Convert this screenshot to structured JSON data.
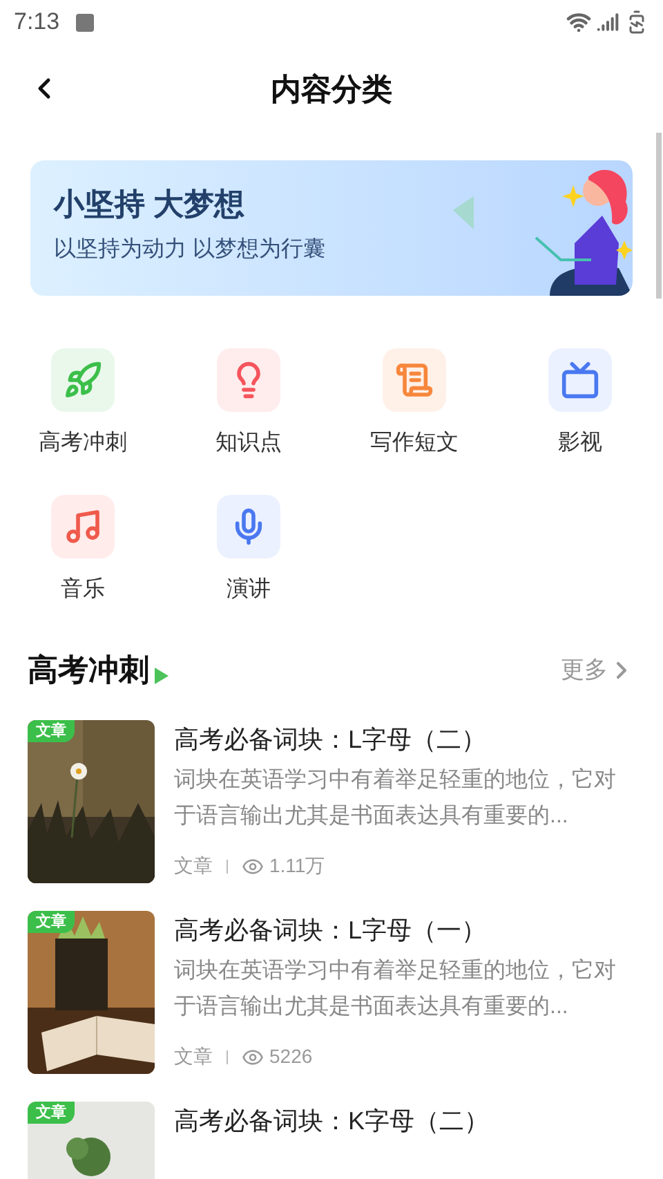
{
  "status_bar": {
    "time": "7:13"
  },
  "header": {
    "title": "内容分类"
  },
  "banner": {
    "headline": "小坚持 大梦想",
    "subline": "以坚持为动力 以梦想为行囊"
  },
  "categories": [
    {
      "label": "高考冲刺"
    },
    {
      "label": "知识点"
    },
    {
      "label": "写作短文"
    },
    {
      "label": "影视"
    },
    {
      "label": "音乐"
    },
    {
      "label": "演讲"
    }
  ],
  "section": {
    "title": "高考冲刺",
    "more": "更多"
  },
  "articles": [
    {
      "badge": "文章",
      "title": "高考必备词块：L字母（二）",
      "summary": "词块在英语学习中有着举足轻重的地位，它对于语言输出尤其是书面表达具有重要的...",
      "type": "文章",
      "views": "1.11万"
    },
    {
      "badge": "文章",
      "title": "高考必备词块：L字母（一）",
      "summary": "词块在英语学习中有着举足轻重的地位，它对于语言输出尤其是书面表达具有重要的...",
      "type": "文章",
      "views": "5226"
    },
    {
      "badge": "文章",
      "title": "高考必备词块：K字母（二）"
    }
  ]
}
